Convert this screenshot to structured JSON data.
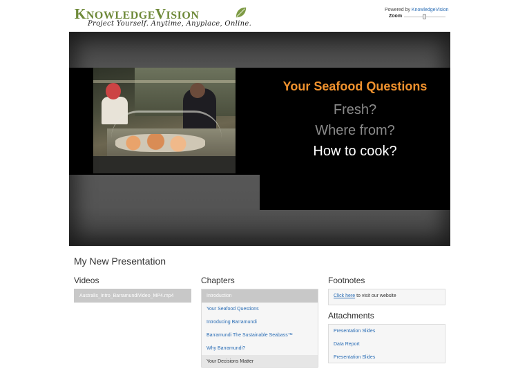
{
  "header": {
    "logo_text_knowledge_k": "K",
    "logo_text_knowledge_rest": "NOWLEDGE",
    "logo_text_vision_v": "V",
    "logo_text_vision_rest": "ISION",
    "tagline": "Project Yourself. Anytime, Anyplace, Online.",
    "powered_by_label": "Powered by",
    "powered_by_link": "KnowledgeVision",
    "zoom_label": "Zoom",
    "zoom_level": 0.45
  },
  "slide": {
    "title": "Your Seafood Questions",
    "lines": [
      "Fresh?",
      "Where from?",
      "How to cook?"
    ],
    "title_color": "#f0922e"
  },
  "presentation": {
    "title": "My New Presentation"
  },
  "videos": {
    "heading": "Videos",
    "items": [
      "Australis_Intro_BarramundiVideo_MP4.mp4"
    ]
  },
  "chapters": {
    "heading": "Chapters",
    "items": [
      "Introduction",
      "Your Seafood Questions",
      "Introducing Barramundi",
      "Barramundi The Sustainable Seabass™",
      "Why Barramundi?",
      "Your Decisions Matter"
    ]
  },
  "footnotes": {
    "heading": "Footnotes",
    "link_text": "Click here",
    "rest_text": " to visit our website"
  },
  "attachments": {
    "heading": "Attachments",
    "items": [
      "Presentation Slides",
      "Data Report",
      "Presentation Slides"
    ]
  },
  "colors": {
    "accent_link": "#2a6db5",
    "logo_green": "#6f8a3a"
  }
}
